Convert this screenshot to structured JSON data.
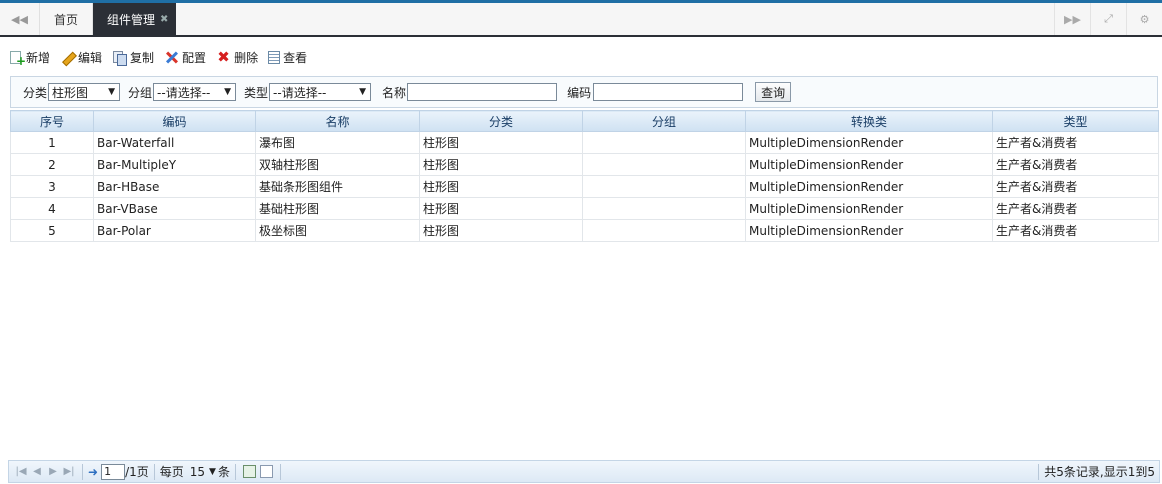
{
  "tabs": {
    "home": "首页",
    "active": "组件管理",
    "close": "✖"
  },
  "toolbar": {
    "new": "新增",
    "edit": "编辑",
    "copy": "复制",
    "config": "配置",
    "delete": "删除",
    "view": "查看"
  },
  "search": {
    "category_label": "分类",
    "category_value": "柱形图",
    "group_label": "分组",
    "group_value": "--请选择--",
    "type_label": "类型",
    "type_value": "--请选择--",
    "name_label": "名称",
    "name_value": "",
    "code_label": "编码",
    "code_value": "",
    "query_button": "查询"
  },
  "table": {
    "headers": [
      "序号",
      "编码",
      "名称",
      "分类",
      "分组",
      "转换类",
      "类型"
    ],
    "rows": [
      [
        "1",
        "Bar-Waterfall",
        "瀑布图",
        "柱形图",
        "",
        "MultipleDimensionRender",
        "生产者&消费者"
      ],
      [
        "2",
        "Bar-MultipleY",
        "双轴柱形图",
        "柱形图",
        "",
        "MultipleDimensionRender",
        "生产者&消费者"
      ],
      [
        "3",
        "Bar-HBase",
        "基础条形图组件",
        "柱形图",
        "",
        "MultipleDimensionRender",
        "生产者&消费者"
      ],
      [
        "4",
        "Bar-VBase",
        "基础柱形图",
        "柱形图",
        "",
        "MultipleDimensionRender",
        "生产者&消费者"
      ],
      [
        "5",
        "Bar-Polar",
        "极坐标图",
        "柱形图",
        "",
        "MultipleDimensionRender",
        "生产者&消费者"
      ]
    ]
  },
  "pager": {
    "page_input": "1",
    "page_total": "/1页",
    "per_page_label": "每页",
    "per_page_value": "15",
    "per_page_unit": "条",
    "info": "共5条记录,显示1到5"
  }
}
